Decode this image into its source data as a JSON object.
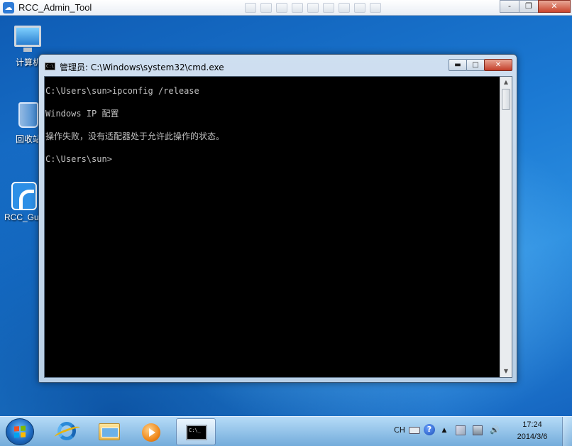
{
  "rdp_window": {
    "title": "RCC_Admin_Tool",
    "icon": "cloud-app-icon",
    "buttons": {
      "minimize": "-",
      "restore": "❐",
      "close": "✕"
    }
  },
  "desktop_icons": [
    {
      "label": "计算机",
      "icon": "computer-icon"
    },
    {
      "label": "回收站",
      "icon": "recycle-bin-icon"
    },
    {
      "label": "RCC_Guest",
      "icon": "rcc-app-icon"
    }
  ],
  "cmd_window": {
    "title": "管理员: C:\\Windows\\system32\\cmd.exe",
    "icon_text": "C:\\",
    "buttons": {
      "minimize": "▬",
      "maximize": "□",
      "close": "✕"
    },
    "lines": [
      "C:\\Users\\sun>ipconfig /release",
      "Windows IP 配置",
      "操作失败，没有适配器处于允许此操作的状态。",
      "C:\\Users\\sun>"
    ],
    "scroll_up": "▲",
    "scroll_down": "▼"
  },
  "taskbar": {
    "pinned": [
      {
        "name": "internet-explorer",
        "icon": "ie-icon"
      },
      {
        "name": "windows-explorer",
        "icon": "folder-icon"
      },
      {
        "name": "media-player",
        "icon": "media-player-icon"
      },
      {
        "name": "command-prompt",
        "icon": "cmd-icon",
        "active": true,
        "glyph_text": "C:\\_"
      }
    ],
    "tray": {
      "language": "CH",
      "help": "?",
      "expand": "▲",
      "volume": "🔊"
    },
    "clock": {
      "time": "17:24",
      "date": "2014/3/6"
    }
  }
}
